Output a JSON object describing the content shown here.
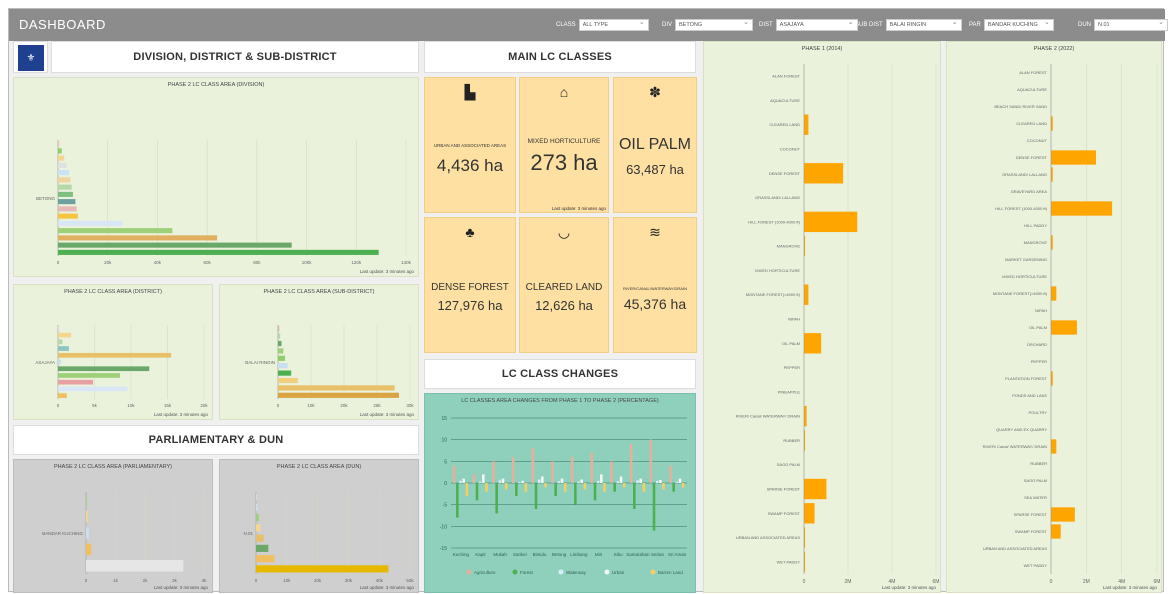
{
  "header": {
    "title": "DASHBOARD"
  },
  "filters": [
    {
      "label": "CLASS",
      "value": "ALL TYPE"
    },
    {
      "label": "DIV",
      "value": "BETONG"
    },
    {
      "label": "DIST",
      "value": "ASAJAYA"
    },
    {
      "label": "SUB DIST",
      "value": "BALAI RINGIN"
    },
    {
      "label": "PAR",
      "value": "BANDAR KUCHING"
    },
    {
      "label": "DUN",
      "value": "N.01"
    }
  ],
  "sections": {
    "division": "DIVISION, DISTRICT & SUB-DISTRICT",
    "main": "MAIN LC CLASSES",
    "changes": "LC CLASS CHANGES",
    "parliament": "PARLIAMENTARY & DUN"
  },
  "panel_titles": {
    "division": "PHASE 2 LC CLASS AREA (DIVISION)",
    "district": "PHASE 2 LC CLASS AREA (DISTRICT)",
    "subdistrict": "PHASE 2 LC CLASS AREA (SUB-DISTRICT)",
    "parliamentary": "PHASE 2 LC CLASS AREA (PARLIAMENTARY)",
    "dun": "PHASE 2 LC CLASS AREA (DUN)",
    "changes": "LC CLASSES AREA CHANGES FROM PHASE 1 TO PHASE 2 (PERCENTAGE)",
    "phase1": "PHASE 1 (2014)",
    "phase2": "PHASE 2 (2022)"
  },
  "last_update": "Last update: 3 minutes ago",
  "cards": [
    {
      "label": "URBAN AND ASSOCIATED AREAS",
      "value": "4,436 ha",
      "icon": "building-icon"
    },
    {
      "label": "MIXED HORTICULTURE",
      "value": "273 ha",
      "icon": "farm-icon",
      "note": "Last update: 3 minutes ago"
    },
    {
      "label": "OIL PALM",
      "value": "63,487 ha",
      "icon": "palm-icon"
    },
    {
      "label": "DENSE FOREST",
      "value": "127,976 ha",
      "icon": "trees-icon"
    },
    {
      "label": "CLEARED LAND",
      "value": "12,626 ha",
      "icon": "bowl-icon"
    },
    {
      "label": "RIVER/CANAL/WATERWAY/DRAIN",
      "value": "45,376 ha",
      "icon": "water-icon"
    }
  ],
  "colors": {
    "orange": "#ffa500",
    "panel": "#eaf2dc",
    "card": "#ffe0a3",
    "teal": "#8fd0bd"
  },
  "chart_data": [
    {
      "type": "bar",
      "title": "PHASE 2 LC CLASS AREA (DIVISION)",
      "orientation": "horizontal",
      "categories": [
        "BETONG"
      ],
      "xticks": [
        "0",
        "20k",
        "40k",
        "60k",
        "80k",
        "100k",
        "120k",
        "140k"
      ],
      "xlim": [
        0,
        140000
      ],
      "values": [
        500,
        1500,
        2500,
        3500,
        4500,
        5000,
        5500,
        6000,
        7000,
        7500,
        8000,
        26000,
        46000,
        64000,
        94000,
        129000
      ],
      "colors": [
        "#f7c0c0",
        "#8fce6a",
        "#f5d58f",
        "#e0e0e0",
        "#c8e3f5",
        "#f0d4a0",
        "#b6d7a8",
        "#7fbf7f",
        "#6fa0a0",
        "#e6b8b8",
        "#f5c542",
        "#d9e6f5",
        "#9ed07a",
        "#e0b060",
        "#6aa86a",
        "#4caf50"
      ]
    },
    {
      "type": "bar",
      "title": "PHASE 2 LC CLASS AREA (DISTRICT)",
      "orientation": "horizontal",
      "categories": [
        "ASAJAYA"
      ],
      "xticks": [
        "0",
        "5k",
        "10k",
        "15k",
        "20k"
      ],
      "xlim": [
        0,
        20000
      ],
      "values": [
        200,
        1800,
        600,
        1500,
        15500,
        400,
        12500,
        8500,
        4800,
        9500,
        1200
      ],
      "colors": [
        "#e0e0e0",
        "#f5d58f",
        "#b6d7a8",
        "#8fc4c4",
        "#e8c06a",
        "#c9dff0",
        "#6aa86a",
        "#9ed07a",
        "#e6a0a0",
        "#d9e6f5",
        "#f0c060"
      ]
    },
    {
      "type": "bar",
      "title": "PHASE 2 LC CLASS AREA (SUB-DISTRICT)",
      "orientation": "horizontal",
      "categories": [
        "BALAI RINGIN"
      ],
      "xticks": [
        "0",
        "10k",
        "20k",
        "25k",
        "30k"
      ],
      "xlim": [
        0,
        30000
      ],
      "values": [
        300,
        500,
        800,
        1200,
        1600,
        2200,
        3000,
        4500,
        26500,
        27500
      ],
      "colors": [
        "#e0b0b0",
        "#b6d7a8",
        "#6aa86a",
        "#9ed07a",
        "#8fce6a",
        "#c9dff0",
        "#4caf50",
        "#f0d080",
        "#e8c06a",
        "#d9a441"
      ]
    },
    {
      "type": "bar",
      "title": "PHASE 2 LC CLASS AREA (PARLIAMENTARY)",
      "orientation": "horizontal",
      "categories": [
        "BANDAR KUCHING"
      ],
      "xticks": [
        "0",
        "1k",
        "2k",
        "3k",
        "4k"
      ],
      "xlim": [
        0,
        4000
      ],
      "values": [
        30,
        60,
        100,
        180,
        3300
      ],
      "colors": [
        "#9ed07a",
        "#f5d58f",
        "#c9dff0",
        "#f0c060",
        "#e6e6e6"
      ]
    },
    {
      "type": "bar",
      "title": "PHASE 2 LC CLASS AREA (DUN)",
      "orientation": "horizontal",
      "categories": [
        "N.01"
      ],
      "xticks": [
        "0",
        "10k",
        "20k",
        "30k",
        "40k",
        "50k"
      ],
      "xlim": [
        0,
        50000
      ],
      "values": [
        200,
        500,
        900,
        1500,
        2500,
        4000,
        6000,
        43000
      ],
      "colors": [
        "#e0e0e0",
        "#c9dff0",
        "#9ed07a",
        "#f5d58f",
        "#e8c06a",
        "#6aa86a",
        "#f0c060",
        "#e6b800"
      ]
    },
    {
      "type": "bar",
      "title": "LC CLASSES AREA CHANGES FROM PHASE 1 TO PHASE 2 (PERCENTAGE)",
      "categories": [
        "Kuching",
        "Kapit",
        "Mukah",
        "Sarikei",
        "Bintulu",
        "Betong",
        "Limbang",
        "Miri",
        "Sibu",
        "Samarahan",
        "Serian",
        "Sri Aman"
      ],
      "yticks": [
        15,
        10,
        5,
        0,
        -5,
        -10,
        -15
      ],
      "ylim": [
        -15,
        15
      ],
      "series": [
        {
          "name": "Agriculture",
          "color": "#e6b09a",
          "values": [
            4,
            2,
            5,
            6,
            8,
            5,
            6,
            7,
            5,
            9,
            10,
            4
          ]
        },
        {
          "name": "Forest",
          "color": "#4caf50",
          "values": [
            -8,
            -4,
            -7,
            -3,
            -6,
            -3,
            -5,
            -4,
            -2,
            -6,
            -11,
            -2
          ]
        },
        {
          "name": "Waterway",
          "color": "#d6eefa",
          "values": [
            0.5,
            0.3,
            0.6,
            0.2,
            0.8,
            0.4,
            0.3,
            0.5,
            0.4,
            0.6,
            0.5,
            0.3
          ]
        },
        {
          "name": "Urban",
          "color": "#f5f5f5",
          "values": [
            1,
            2,
            1,
            0.5,
            1.5,
            1,
            0.8,
            2,
            1.5,
            1,
            0.7,
            1
          ]
        },
        {
          "name": "Barren Land",
          "color": "#f5d060",
          "values": [
            -3,
            -2,
            -1.5,
            -2,
            -1,
            -2,
            -1.5,
            -2,
            -1,
            -2,
            -1.5,
            -1
          ]
        }
      ]
    },
    {
      "type": "bar",
      "title": "PHASE 1 (2014)",
      "orientation": "horizontal",
      "categories": [
        "ALAN FOREST",
        "AQUACULTURE",
        "CLEARED LAND",
        "COCONUT",
        "DENSE FOREST",
        "GRASSLAND/ LALLANG",
        "HILL FOREST (1000-4000 ft)",
        "MANGROVE",
        "MIXED HORTICULTURE",
        "MONTANE FOREST(>4000 ft)",
        "NIPAH",
        "OIL PALM",
        "PEPPER",
        "PINEAPPLE",
        "RIVER/ Canal/ WATERWAY/ DRAIN",
        "RUBBER",
        "SAGO PALM",
        "SPARSE FOREST",
        "SWAMP FOREST",
        "URBAN AND ASSOCIATED AREAS",
        "WET PADDY"
      ],
      "values": [
        0,
        0,
        200000,
        0,
        1780000,
        0,
        2420000,
        50000,
        0,
        200000,
        0,
        780000,
        0,
        0,
        120000,
        50000,
        0,
        1020000,
        480000,
        50000,
        50000
      ],
      "xticks": [
        "0",
        "2M",
        "4M",
        "6M"
      ],
      "xlim": [
        0,
        6000000
      ]
    },
    {
      "type": "bar",
      "title": "PHASE 2 (2022)",
      "orientation": "horizontal",
      "categories": [
        "ALAN FOREST",
        "AQUACULTURE",
        "BEACH SAND/ RIVER SAND",
        "CLEARED LAND",
        "COCONUT",
        "DENSE FOREST",
        "GRASSLAND/ LALLANG",
        "GRAVEYARD AREA",
        "HILL FOREST (1000-4000 ft)",
        "HILL PADDY",
        "MANGROVE",
        "MARKET GARDENING",
        "MIXED HORTICULTURE",
        "MONTANE FOREST(>4000 ft)",
        "NIPAH",
        "OIL PALM",
        "ORCHARD",
        "PEPPER",
        "PLANTATION FOREST",
        "PONDS AND LAKE",
        "POULTRY",
        "QUARRY AND EX QUARRY",
        "RIVER/ Canal/ WATERWAY/ DRAIN",
        "RUBBER",
        "SAGO PALM",
        "SEA WATER",
        "SPARSE FOREST",
        "SWAMP FOREST",
        "URBAN AND ASSOCIATED AREAS",
        "WET PADDY"
      ],
      "values": [
        0,
        0,
        0,
        100000,
        0,
        2550000,
        100000,
        0,
        3460000,
        0,
        100000,
        0,
        0,
        300000,
        0,
        1470000,
        0,
        0,
        100000,
        0,
        0,
        0,
        300000,
        0,
        0,
        0,
        1350000,
        550000,
        0,
        0
      ],
      "xticks": [
        "0",
        "2M",
        "4M",
        "6M"
      ],
      "xlim": [
        0,
        6000000
      ]
    }
  ]
}
